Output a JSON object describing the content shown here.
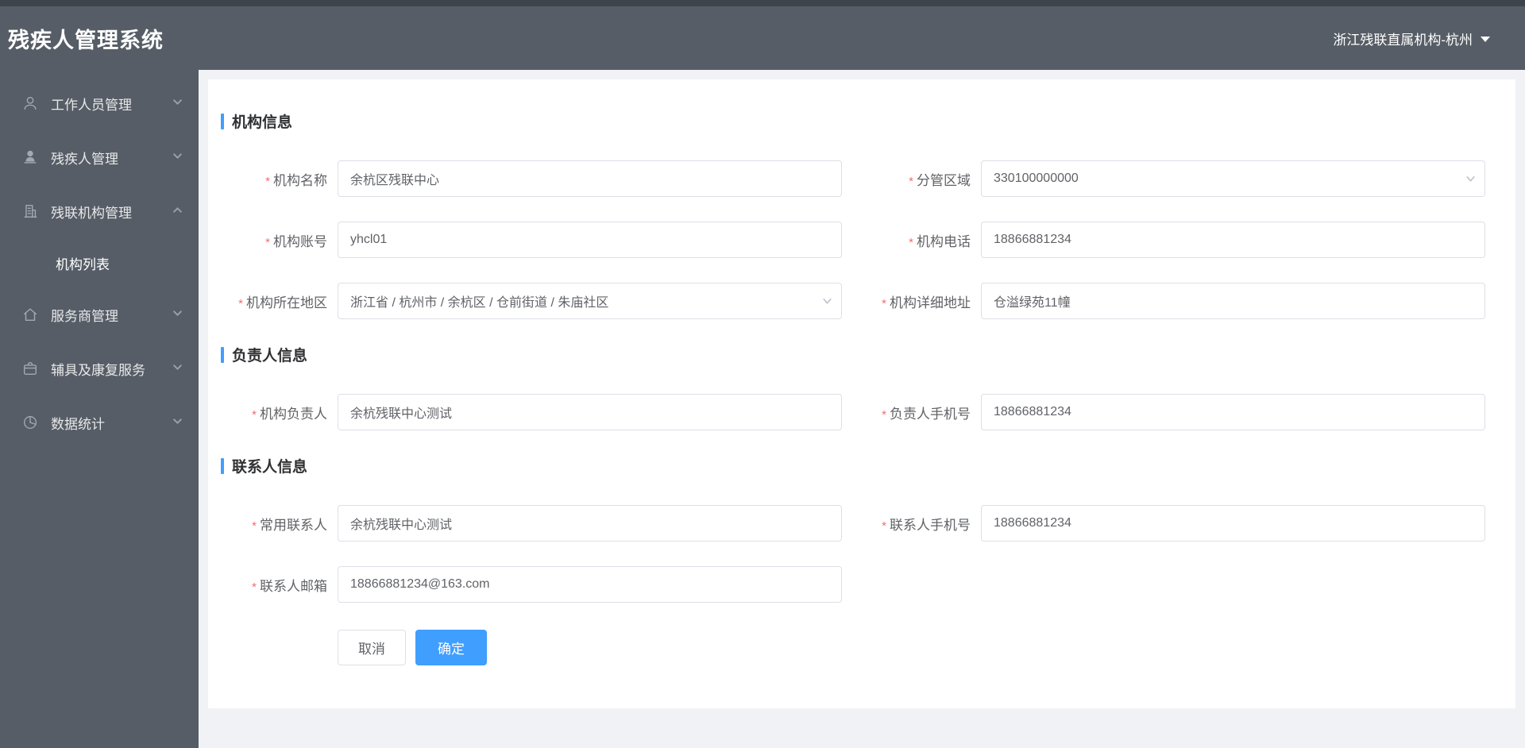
{
  "app": {
    "title": "残疾人管理系统"
  },
  "header": {
    "org_switcher": "浙江残联直属机构-杭州"
  },
  "sidebar": {
    "items": [
      {
        "label": "工作人员管理",
        "icon": "user-icon",
        "state": "collapsed"
      },
      {
        "label": "残疾人管理",
        "icon": "user-filled-icon",
        "state": "collapsed"
      },
      {
        "label": "残联机构管理",
        "icon": "building-icon",
        "state": "expanded",
        "children": [
          {
            "label": "机构列表",
            "active": true
          }
        ]
      },
      {
        "label": "服务商管理",
        "icon": "home-icon",
        "state": "collapsed"
      },
      {
        "label": "辅具及康复服务",
        "icon": "briefcase-icon",
        "state": "collapsed"
      },
      {
        "label": "数据统计",
        "icon": "pie-chart-icon",
        "state": "collapsed"
      }
    ]
  },
  "form": {
    "required_marker": "*",
    "sections": [
      {
        "title": "机构信息"
      },
      {
        "title": "负责人信息"
      },
      {
        "title": "联系人信息"
      }
    ],
    "fields": {
      "org_name": {
        "label": "机构名称",
        "value": "余杭区残联中心",
        "required": true,
        "type": "text"
      },
      "region": {
        "label": "分管区域",
        "value": "330100000000",
        "required": true,
        "type": "select"
      },
      "org_account": {
        "label": "机构账号",
        "value": "yhcl01",
        "required": true,
        "type": "text"
      },
      "org_phone": {
        "label": "机构电话",
        "value": "18866881234",
        "required": true,
        "type": "text"
      },
      "org_area": {
        "label": "机构所在地区",
        "value": "浙江省 / 杭州市 / 余杭区 / 仓前街道 / 朱庙社区",
        "required": true,
        "type": "cascader"
      },
      "org_address": {
        "label": "机构详细地址",
        "value": "仓溢绿苑11幢",
        "required": true,
        "type": "text"
      },
      "org_leader": {
        "label": "机构负责人",
        "value": "余杭残联中心测试",
        "required": true,
        "type": "text"
      },
      "leader_mobile": {
        "label": "负责人手机号",
        "value": "18866881234",
        "required": true,
        "type": "text"
      },
      "contact_person": {
        "label": "常用联系人",
        "value": "余杭残联中心测试",
        "required": true,
        "type": "text"
      },
      "contact_mobile": {
        "label": "联系人手机号",
        "value": "18866881234",
        "required": true,
        "type": "text"
      },
      "contact_email": {
        "label": "联系人邮箱",
        "value": "18866881234@163.com",
        "required": true,
        "type": "text"
      }
    },
    "buttons": {
      "cancel": "取消",
      "confirm": "确定"
    }
  },
  "colors": {
    "accent": "#409eff",
    "required": "#f56c6c",
    "header_bg": "#565d66",
    "header_top_strip": "#3d444c",
    "panel_bg": "#ffffff",
    "page_bg": "#f1f2f5",
    "input_border": "#dcdfe6"
  }
}
